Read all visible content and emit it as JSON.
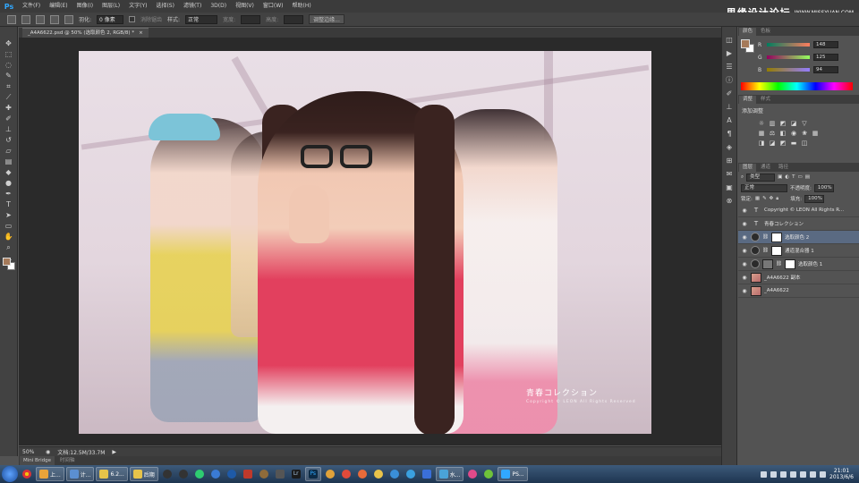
{
  "menubar": {
    "app_logo": "Ps",
    "items": [
      "文件(F)",
      "编辑(E)",
      "图像(I)",
      "图层(L)",
      "文字(Y)",
      "选择(S)",
      "滤镜(T)",
      "3D(D)",
      "视图(V)",
      "窗口(W)",
      "帮助(H)"
    ]
  },
  "watermark": {
    "cn": "思缘设计论坛",
    "en": "WWW.MISSYUAN.COM"
  },
  "options": {
    "feather_label": "羽化:",
    "feather_value": "0 像素",
    "antialias_label": "消除锯齿",
    "style_label": "样式:",
    "style_value": "正常",
    "width_label": "宽度:",
    "height_label": "高度:",
    "refine_button": "调整边缘..."
  },
  "document": {
    "tab_title": "_A4A6622.psd @ 50% (选取颜色 2, RGB/8) *",
    "close_glyph": "×",
    "caption_title": "青春コレクション",
    "caption_sub": "Copyright © LEON All Rights Reserved"
  },
  "status": {
    "zoom": "50%",
    "doc_size": "文档:12.5M/33.7M"
  },
  "bottom_tabs": [
    "Mini Bridge",
    "时间轴"
  ],
  "color_panel": {
    "tabs": [
      "颜色",
      "色板"
    ],
    "r_label": "R",
    "r_value": "148",
    "g_label": "G",
    "g_value": "125",
    "b_label": "B",
    "b_value": "94",
    "fg_color": "#a57a5a"
  },
  "adjust_panel": {
    "tabs": [
      "调整",
      "样式"
    ],
    "title": "添加调整"
  },
  "layers_panel": {
    "tabs": [
      "图层",
      "通道",
      "路径"
    ],
    "kind_label": "类型",
    "blend_mode": "正常",
    "opacity_label": "不透明度:",
    "opacity_value": "100%",
    "lock_label": "锁定:",
    "fill_label": "填充:",
    "fill_value": "100%",
    "layers": [
      {
        "name": "Copyright © LEON All Rights R...",
        "kind": "text"
      },
      {
        "name": "青春コレクション",
        "kind": "text"
      },
      {
        "name": "选取颜色 2",
        "kind": "adjustment",
        "selected": true
      },
      {
        "name": "通道混合器 1",
        "kind": "adjustment"
      },
      {
        "name": "选取颜色 1",
        "kind": "adjustment-mask"
      },
      {
        "name": "_A4A6622 副本",
        "kind": "photo"
      },
      {
        "name": "_A4A6622",
        "kind": "photo"
      }
    ]
  },
  "taskbar": {
    "items": [
      {
        "label": "上...",
        "color": "#e8a33a"
      },
      {
        "label": "计...",
        "color": "#5b8fd1"
      },
      {
        "label": "6.2...",
        "color": "#e6c34a"
      },
      {
        "label": "后期",
        "color": "#e6c34a"
      },
      {
        "label": "水...",
        "color": "#4aa3d9"
      },
      {
        "label": "PS...",
        "color": "#31a8ff"
      }
    ],
    "lr_label": "Lr",
    "ps_label": "Ps",
    "time": "21:01",
    "date": "2013/6/6"
  }
}
